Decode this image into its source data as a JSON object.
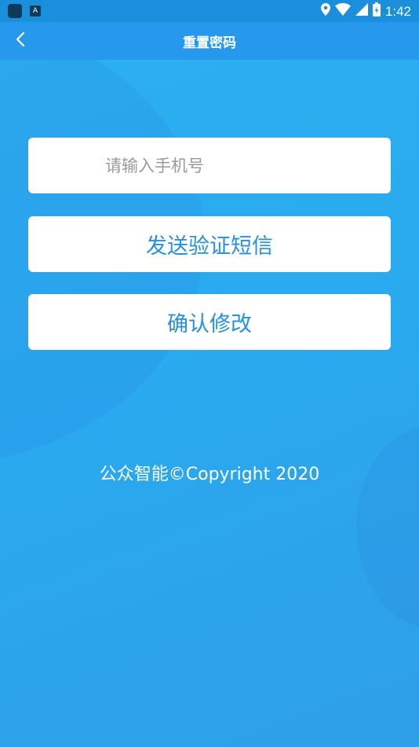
{
  "status_bar": {
    "time": "1:42",
    "icons": [
      "app-square-icon",
      "a-notification-icon",
      "location-icon",
      "wifi-icon",
      "signal-icon",
      "battery-icon"
    ]
  },
  "app_bar": {
    "title": "重置密码",
    "back_icon": "chevron-left-icon"
  },
  "form": {
    "phone_placeholder": "请输入手机号",
    "phone_value": "",
    "send_sms_label": "发送验证短信",
    "confirm_label": "确认修改"
  },
  "footer": {
    "copyright": "公众智能©Copyright 2020"
  },
  "colors": {
    "background": "#2aa9ef",
    "app_bar": "#2699ec",
    "button_text": "#2591e6"
  }
}
